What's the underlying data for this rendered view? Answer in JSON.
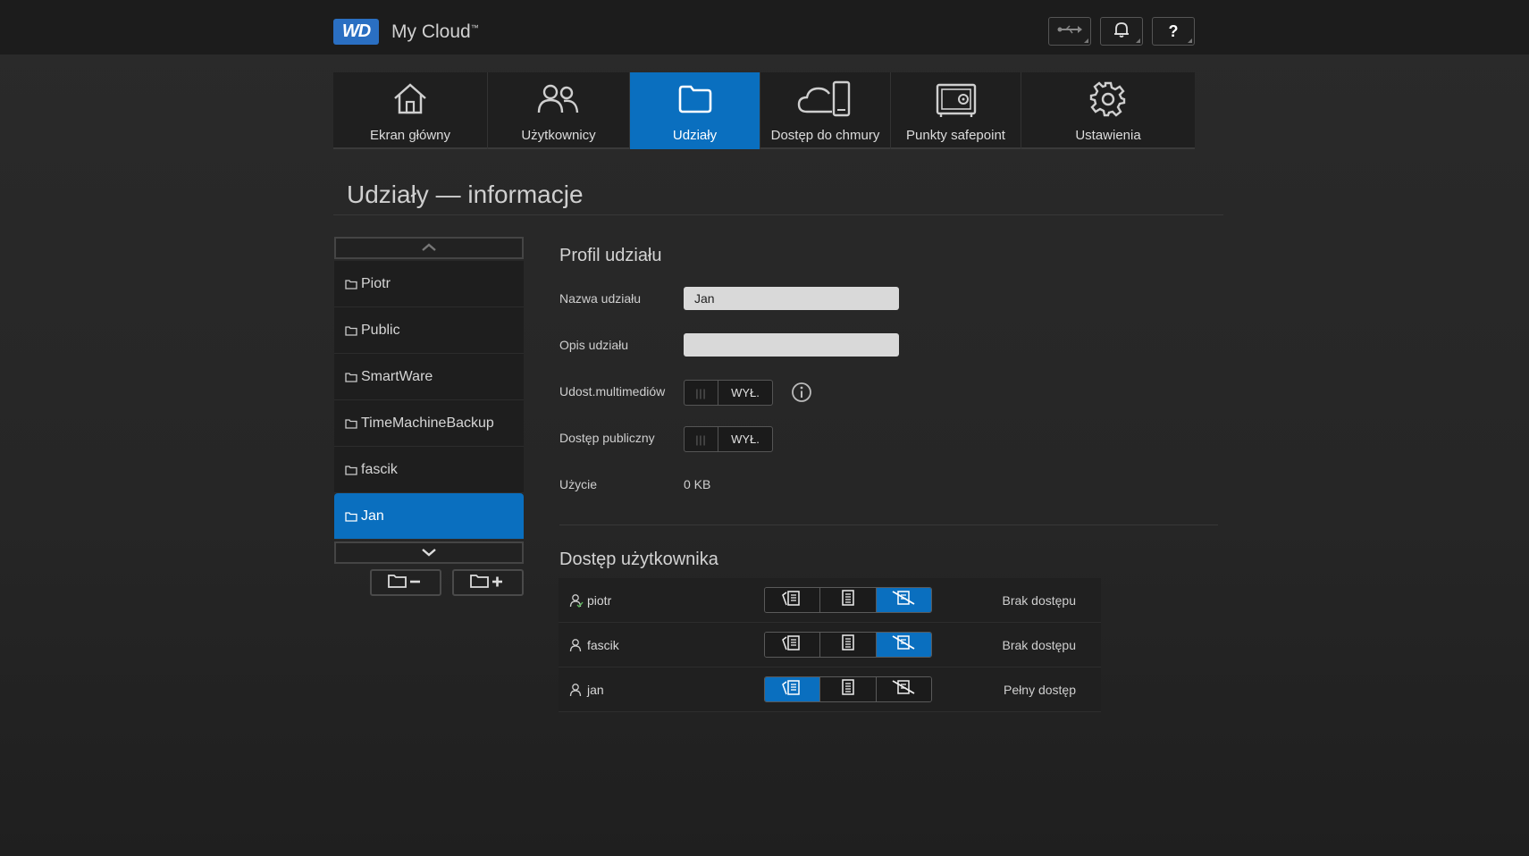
{
  "header": {
    "logo": "WD",
    "app_title": "My Cloud",
    "app_title_tm": "™"
  },
  "toolbar": {
    "usb_icon": "usb-icon",
    "bell_icon": "bell-icon",
    "help_label": "?"
  },
  "nav": {
    "tabs": [
      {
        "label": "Ekran główny",
        "icon": "home-icon",
        "active": false
      },
      {
        "label": "Użytkownicy",
        "icon": "users-icon",
        "active": false
      },
      {
        "label": "Udziały",
        "icon": "folder-icon",
        "active": true
      },
      {
        "label": "Dostęp do chmury",
        "icon": "cloud-device-icon",
        "active": false
      },
      {
        "label": "Punkty safepoint",
        "icon": "safe-icon",
        "active": false
      },
      {
        "label": "Ustawienia",
        "icon": "gear-icon",
        "active": false
      }
    ]
  },
  "page": {
    "title": "Udziały — informacje"
  },
  "shares": {
    "items": [
      {
        "name": "Piotr",
        "selected": false
      },
      {
        "name": "Public",
        "selected": false
      },
      {
        "name": "SmartWare",
        "selected": false
      },
      {
        "name": "TimeMachineBackup",
        "selected": false
      },
      {
        "name": "fascik",
        "selected": false
      },
      {
        "name": "Jan",
        "selected": true
      }
    ]
  },
  "profile": {
    "section_title": "Profil udziału",
    "name_label": "Nazwa udziału",
    "name_value": "Jan",
    "desc_label": "Opis udziału",
    "desc_value": "",
    "media_label": "Udost.multimediów",
    "media_value": "WYŁ.",
    "public_label": "Dostęp publiczny",
    "public_value": "WYŁ.",
    "usage_label": "Użycie",
    "usage_value": "0 KB"
  },
  "access": {
    "section_title": "Dostęp użytkownika",
    "users": [
      {
        "name": "piotr",
        "permission": 2,
        "status": "Brak dostępu"
      },
      {
        "name": "fascik",
        "permission": 2,
        "status": "Brak dostępu"
      },
      {
        "name": "jan",
        "permission": 0,
        "status": "Pełny dostęp"
      }
    ]
  },
  "colors": {
    "accent": "#0a6fbf",
    "background": "#262626",
    "header": "#1c1c1c"
  }
}
